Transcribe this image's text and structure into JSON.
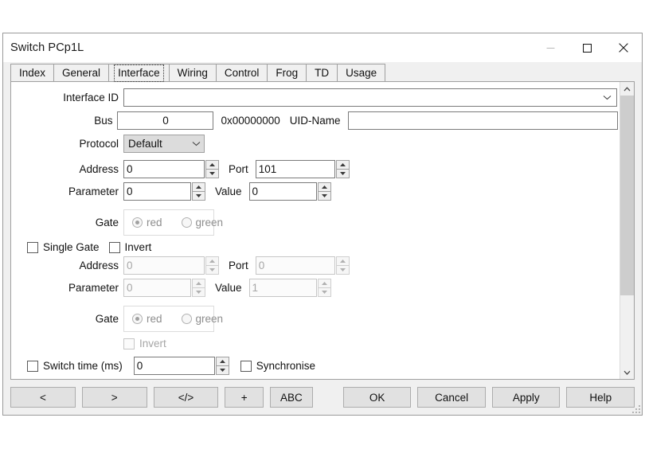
{
  "window": {
    "title": "Switch PCp1L",
    "controls": {
      "minimize": "minimize-button",
      "maximize": "maximize-button",
      "close": "close-button"
    }
  },
  "tabs": [
    {
      "label": "Index",
      "selected": false
    },
    {
      "label": "General",
      "selected": false
    },
    {
      "label": "Interface",
      "selected": true
    },
    {
      "label": "Wiring",
      "selected": false
    },
    {
      "label": "Control",
      "selected": false
    },
    {
      "label": "Frog",
      "selected": false
    },
    {
      "label": "TD",
      "selected": false
    },
    {
      "label": "Usage",
      "selected": false
    }
  ],
  "form": {
    "interface_id": {
      "label": "Interface ID",
      "value": "",
      "placeholder": ""
    },
    "bus": {
      "label": "Bus",
      "value": "0",
      "hex": "0x00000000"
    },
    "uid_name": {
      "label": "UID-Name",
      "value": "",
      "placeholder": ""
    },
    "protocol": {
      "label": "Protocol",
      "value": "Default",
      "options": [
        "Default"
      ]
    },
    "address": {
      "label": "Address",
      "value": "0"
    },
    "port": {
      "label": "Port",
      "value": "101"
    },
    "parameter": {
      "label": "Parameter",
      "value": "0"
    },
    "value": {
      "label": "Value",
      "value": "0"
    },
    "gate1": {
      "label": "Gate",
      "options": [
        {
          "label": "red",
          "selected": true
        },
        {
          "label": "green",
          "selected": false
        }
      ]
    },
    "single_gate": {
      "label": "Single Gate",
      "checked": false
    },
    "invert1": {
      "label": "Invert",
      "checked": false
    },
    "address2": {
      "label": "Address",
      "value": "0"
    },
    "port2": {
      "label": "Port",
      "value": "0"
    },
    "parameter2": {
      "label": "Parameter",
      "value": "0"
    },
    "value2": {
      "label": "Value",
      "value": "1"
    },
    "gate2": {
      "label": "Gate",
      "options": [
        {
          "label": "red",
          "selected": true
        },
        {
          "label": "green",
          "selected": false
        }
      ]
    },
    "invert2": {
      "label": "Invert",
      "checked": false
    },
    "switch_time": {
      "label": "Switch time (ms)",
      "checked": false,
      "value": "0"
    },
    "synchronise": {
      "label": "Synchronise",
      "checked": false
    }
  },
  "buttons": {
    "prev": "<",
    "next": ">",
    "code": "</>",
    "add": "+",
    "abc": "ABC",
    "ok": "OK",
    "cancel": "Cancel",
    "apply": "Apply",
    "help": "Help"
  },
  "scrollbar": {
    "up": "scroll-up-arrow",
    "down": "scroll-down-arrow",
    "thumb_percent": 74
  },
  "colors": {
    "window_bg": "#f0f0f0",
    "panel_bg": "#ffffff",
    "border": "#a0a0a0",
    "text": "#111111",
    "disabled_text": "#a6a6a6",
    "button_face": "#e1e1e1",
    "combo_gray": "#dcdcdc",
    "scroll_thumb": "#cdcdcd"
  }
}
